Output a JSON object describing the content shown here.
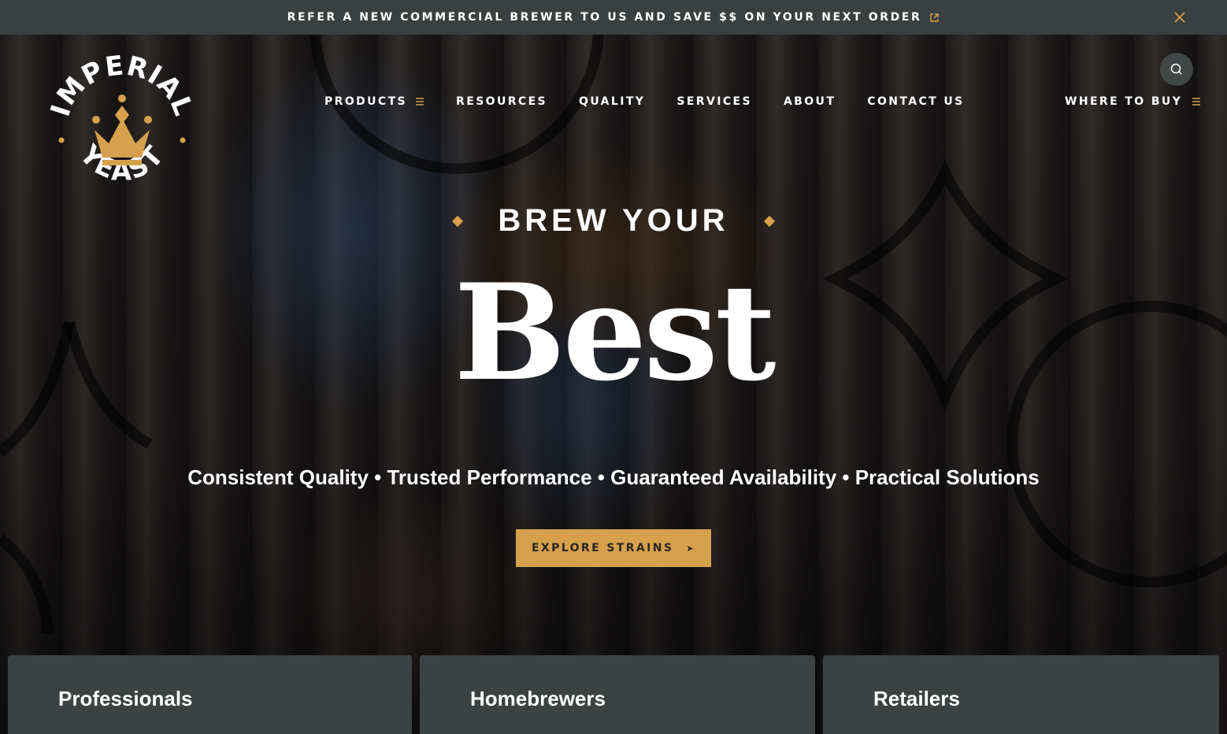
{
  "topbar": {
    "announcement": "REFER A NEW COMMERCIAL BREWER TO US AND SAVE $$ ON YOUR NEXT ORDER",
    "link_icon": "external-link-icon",
    "close_icon": "close-icon"
  },
  "logo": {
    "top_text": "IMPERIAL",
    "bottom_text": "YEAST",
    "icon": "crown-icon"
  },
  "nav": {
    "items": [
      {
        "label": "PRODUCTS",
        "has_menu_icon": true
      },
      {
        "label": "RESOURCES"
      },
      {
        "label": "QUALITY"
      },
      {
        "label": "SERVICES"
      },
      {
        "label": "ABOUT"
      },
      {
        "label": "CONTACT US"
      }
    ],
    "where_to_buy": "WHERE TO BUY",
    "search_icon": "search-icon",
    "menu_icon": "menu-lines-icon"
  },
  "hero": {
    "eyebrow": "BREW YOUR",
    "headline": "Best",
    "tagline": "Consistent Quality • Trusted Performance • Guaranteed Availability • Practical Solutions",
    "cta_label": "EXPLORE STRAINS",
    "cta_icon": "play-arrow-icon"
  },
  "cards": [
    {
      "title": "Professionals"
    },
    {
      "title": "Homebrewers"
    },
    {
      "title": "Retailers"
    }
  ],
  "colors": {
    "accent": "#d6a04c",
    "topbar_bg": "#3a3f3f",
    "card_bg": "#3c4241"
  }
}
